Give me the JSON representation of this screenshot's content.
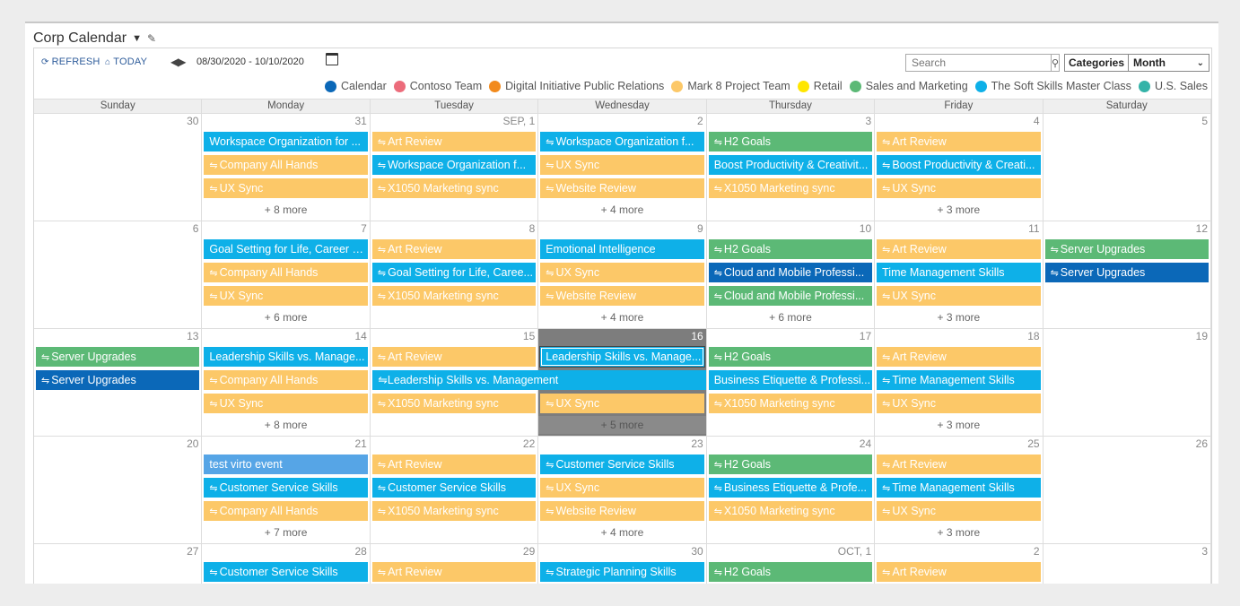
{
  "title": "Corp Calendar",
  "toolbar": {
    "refresh": "REFRESH",
    "today": "TODAY",
    "range": "08/30/2020 - 10/10/2020",
    "search_placeholder": "Search",
    "categories": "Categories",
    "view": "Month"
  },
  "legend": [
    {
      "label": "Calendar",
      "color": "#0b68b8"
    },
    {
      "label": "Contoso Team",
      "color": "#ec6c7b"
    },
    {
      "label": "Digital Initiative Public Relations",
      "color": "#f28a1c"
    },
    {
      "label": "Mark 8 Project Team",
      "color": "#fcc868"
    },
    {
      "label": "Retail",
      "color": "#ffe600"
    },
    {
      "label": "Sales and Marketing",
      "color": "#5cb976"
    },
    {
      "label": "The Soft Skills Master Class",
      "color": "#0eb0e8"
    },
    {
      "label": "U.S. Sales",
      "color": "#34b3a8"
    }
  ],
  "days": [
    "Sunday",
    "Monday",
    "Tuesday",
    "Wednesday",
    "Thursday",
    "Friday",
    "Saturday"
  ],
  "weeks": [
    {
      "cells": [
        {
          "num": "30",
          "events": [],
          "more": ""
        },
        {
          "num": "31",
          "events": [
            {
              "t": "Workspace Organization for ...",
              "c": "softskills",
              "r": false
            },
            {
              "t": "Company All Hands",
              "c": "mark8",
              "r": true
            },
            {
              "t": "UX Sync",
              "c": "mark8",
              "r": true
            }
          ],
          "more": "+ 8 more"
        },
        {
          "num": "SEP, 1",
          "events": [
            {
              "t": "Art Review",
              "c": "mark8",
              "r": true
            },
            {
              "t": "Workspace Organization f...",
              "c": "softskills",
              "r": true
            },
            {
              "t": "X1050 Marketing sync",
              "c": "mark8",
              "r": true
            }
          ],
          "more": ""
        },
        {
          "num": "2",
          "events": [
            {
              "t": "Workspace Organization f...",
              "c": "softskills",
              "r": true
            },
            {
              "t": "UX Sync",
              "c": "mark8",
              "r": true
            },
            {
              "t": "Website Review",
              "c": "mark8",
              "r": true
            }
          ],
          "more": "+ 4 more"
        },
        {
          "num": "3",
          "events": [
            {
              "t": "H2 Goals",
              "c": "sales",
              "r": true
            },
            {
              "t": "Boost Productivity & Creativit...",
              "c": "softskills",
              "r": false
            },
            {
              "t": "X1050 Marketing sync",
              "c": "mark8",
              "r": true
            }
          ],
          "more": ""
        },
        {
          "num": "4",
          "events": [
            {
              "t": "Art Review",
              "c": "mark8",
              "r": true
            },
            {
              "t": "Boost Productivity & Creati...",
              "c": "softskills",
              "r": true
            },
            {
              "t": "UX Sync",
              "c": "mark8",
              "r": true
            }
          ],
          "more": "+ 3 more"
        },
        {
          "num": "5",
          "events": [],
          "more": ""
        }
      ]
    },
    {
      "cells": [
        {
          "num": "6",
          "events": [],
          "more": ""
        },
        {
          "num": "7",
          "events": [
            {
              "t": "Goal Setting for Life, Career &...",
              "c": "softskills",
              "r": false
            },
            {
              "t": "Company All Hands",
              "c": "mark8",
              "r": true
            },
            {
              "t": "UX Sync",
              "c": "mark8",
              "r": true
            }
          ],
          "more": "+ 6 more"
        },
        {
          "num": "8",
          "events": [
            {
              "t": "Art Review",
              "c": "mark8",
              "r": true
            },
            {
              "t": "Goal Setting for Life, Caree...",
              "c": "softskills",
              "r": true
            },
            {
              "t": "X1050 Marketing sync",
              "c": "mark8",
              "r": true
            }
          ],
          "more": ""
        },
        {
          "num": "9",
          "events": [
            {
              "t": "Emotional Intelligence",
              "c": "softskills",
              "r": false
            },
            {
              "t": "UX Sync",
              "c": "mark8",
              "r": true
            },
            {
              "t": "Website Review",
              "c": "mark8",
              "r": true
            }
          ],
          "more": "+ 4 more"
        },
        {
          "num": "10",
          "events": [
            {
              "t": "H2 Goals",
              "c": "sales",
              "r": true
            },
            {
              "t": "Cloud and Mobile Professi...",
              "c": "calendar",
              "r": true
            },
            {
              "t": "Cloud and Mobile Professi...",
              "c": "sales",
              "r": true
            }
          ],
          "more": "+ 6 more"
        },
        {
          "num": "11",
          "events": [
            {
              "t": "Art Review",
              "c": "mark8",
              "r": true
            },
            {
              "t": "Time Management Skills",
              "c": "softskills",
              "r": false
            },
            {
              "t": "UX Sync",
              "c": "mark8",
              "r": true
            }
          ],
          "more": "+ 3 more"
        },
        {
          "num": "12",
          "events": [
            {
              "t": "Server Upgrades",
              "c": "sales",
              "r": true
            },
            {
              "t": "Server Upgrades",
              "c": "calendar",
              "r": true
            }
          ],
          "more": ""
        }
      ]
    },
    {
      "cells": [
        {
          "num": "13",
          "events": [
            {
              "t": "Server Upgrades",
              "c": "sales",
              "r": true
            },
            {
              "t": "Server Upgrades",
              "c": "calendar",
              "r": true
            }
          ],
          "more": ""
        },
        {
          "num": "14",
          "events": [
            {
              "t": "Leadership Skills vs. Manage...",
              "c": "softskills",
              "r": false
            },
            {
              "t": "Company All Hands",
              "c": "mark8",
              "r": true
            },
            {
              "t": "UX Sync",
              "c": "mark8",
              "r": true
            }
          ],
          "more": "+ 8 more"
        },
        {
          "num": "15",
          "events": [
            {
              "t": "Art Review",
              "c": "mark8",
              "r": true
            },
            {
              "t": "",
              "c": "",
              "r": false
            },
            {
              "t": "X1050 Marketing sync",
              "c": "mark8",
              "r": true
            }
          ],
          "more": ""
        },
        {
          "num": "16",
          "today": true,
          "events": [
            {
              "t": "Leadership Skills vs. Manage...",
              "c": "softskills",
              "r": false,
              "o": true
            },
            {
              "t": "",
              "c": "",
              "r": false
            },
            {
              "t": "UX Sync",
              "c": "mark8",
              "r": true
            }
          ],
          "more": "+ 5 more"
        },
        {
          "num": "17",
          "events": [
            {
              "t": "H2 Goals",
              "c": "sales",
              "r": true
            },
            {
              "t": "Business Etiquette & Professi...",
              "c": "softskills",
              "r": false
            },
            {
              "t": "X1050 Marketing sync",
              "c": "mark8",
              "r": true
            }
          ],
          "more": ""
        },
        {
          "num": "18",
          "events": [
            {
              "t": "Art Review",
              "c": "mark8",
              "r": true
            },
            {
              "t": "Time Management Skills",
              "c": "softskills",
              "r": true
            },
            {
              "t": "UX Sync",
              "c": "mark8",
              "r": true
            }
          ],
          "more": "+ 3 more"
        },
        {
          "num": "19",
          "events": [],
          "more": ""
        }
      ],
      "span": {
        "t": "Leadership Skills vs. Management",
        "c": "softskills",
        "start": 2,
        "len": 2,
        "row": 1,
        "r": true
      }
    },
    {
      "cells": [
        {
          "num": "20",
          "events": [],
          "more": ""
        },
        {
          "num": "21",
          "events": [
            {
              "t": "test virto event",
              "c": "test",
              "r": false
            },
            {
              "t": "Customer Service Skills",
              "c": "softskills",
              "r": true
            },
            {
              "t": "Company All Hands",
              "c": "mark8",
              "r": true
            }
          ],
          "more": "+ 7 more"
        },
        {
          "num": "22",
          "events": [
            {
              "t": "Art Review",
              "c": "mark8",
              "r": true
            },
            {
              "t": "Customer Service Skills",
              "c": "softskills",
              "r": true
            },
            {
              "t": "X1050 Marketing sync",
              "c": "mark8",
              "r": true
            }
          ],
          "more": ""
        },
        {
          "num": "23",
          "events": [
            {
              "t": "Customer Service Skills",
              "c": "softskills",
              "r": true
            },
            {
              "t": "UX Sync",
              "c": "mark8",
              "r": true
            },
            {
              "t": "Website Review",
              "c": "mark8",
              "r": true
            }
          ],
          "more": "+ 4 more"
        },
        {
          "num": "24",
          "events": [
            {
              "t": "H2 Goals",
              "c": "sales",
              "r": true
            },
            {
              "t": "Business Etiquette & Profe...",
              "c": "softskills",
              "r": true
            },
            {
              "t": "X1050 Marketing sync",
              "c": "mark8",
              "r": true
            }
          ],
          "more": ""
        },
        {
          "num": "25",
          "events": [
            {
              "t": "Art Review",
              "c": "mark8",
              "r": true
            },
            {
              "t": "Time Management Skills",
              "c": "softskills",
              "r": true
            },
            {
              "t": "UX Sync",
              "c": "mark8",
              "r": true
            }
          ],
          "more": "+ 3 more"
        },
        {
          "num": "26",
          "events": [],
          "more": ""
        }
      ]
    },
    {
      "cells": [
        {
          "num": "27",
          "events": [],
          "more": ""
        },
        {
          "num": "28",
          "events": [
            {
              "t": "Customer Service Skills",
              "c": "softskills",
              "r": true
            }
          ],
          "more": ""
        },
        {
          "num": "29",
          "events": [
            {
              "t": "Art Review",
              "c": "mark8",
              "r": true
            }
          ],
          "more": ""
        },
        {
          "num": "30",
          "events": [
            {
              "t": "Strategic Planning Skills",
              "c": "softskills",
              "r": true
            }
          ],
          "more": ""
        },
        {
          "num": "OCT, 1",
          "events": [
            {
              "t": "H2 Goals",
              "c": "sales",
              "r": true
            }
          ],
          "more": ""
        },
        {
          "num": "2",
          "events": [
            {
              "t": "Art Review",
              "c": "mark8",
              "r": true
            }
          ],
          "more": ""
        },
        {
          "num": "3",
          "events": [],
          "more": ""
        }
      ]
    }
  ]
}
